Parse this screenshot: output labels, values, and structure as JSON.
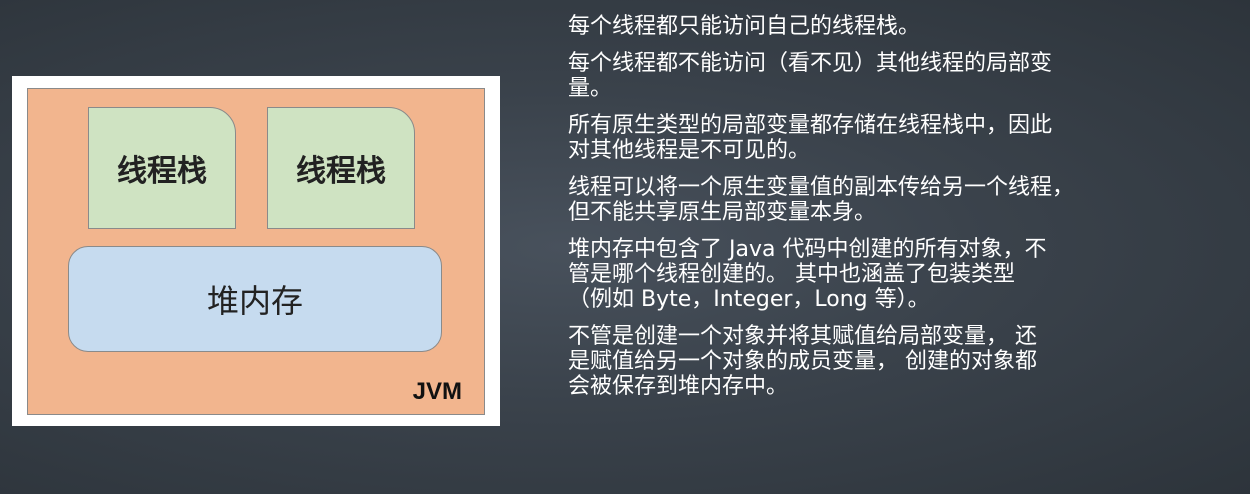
{
  "diagram": {
    "stack_left_label": "线程栈",
    "stack_right_label": "线程栈",
    "heap_label": "堆内存",
    "jvm_label": "JVM",
    "colors": {
      "jvm_fill": "#f2b58e",
      "stack_fill": "#cfe3c2",
      "heap_fill": "#c6dbef",
      "border": "#8a8a8a"
    }
  },
  "paragraphs": [
    "每个线程都只能访问自己的线程栈。",
    "每个线程都不能访问（看不见）其他线程的局部变\n量。",
    "所有原生类型的局部变量都存储在线程栈中，因此\n对其他线程是不可见的。",
    "线程可以将一个原生变量值的副本传给另一个线程，\n但不能共享原生局部变量本身。",
    "堆内存中包含了 Java 代码中创建的所有对象，不\n管是哪个线程创建的。 其中也涵盖了包装类型\n（例如 Byte，Integer，Long 等）。",
    "不管是创建一个对象并将其赋值给局部变量， 还\n是赋值给另一个对象的成员变量， 创建的对象都\n会被保存到堆内存中。"
  ]
}
